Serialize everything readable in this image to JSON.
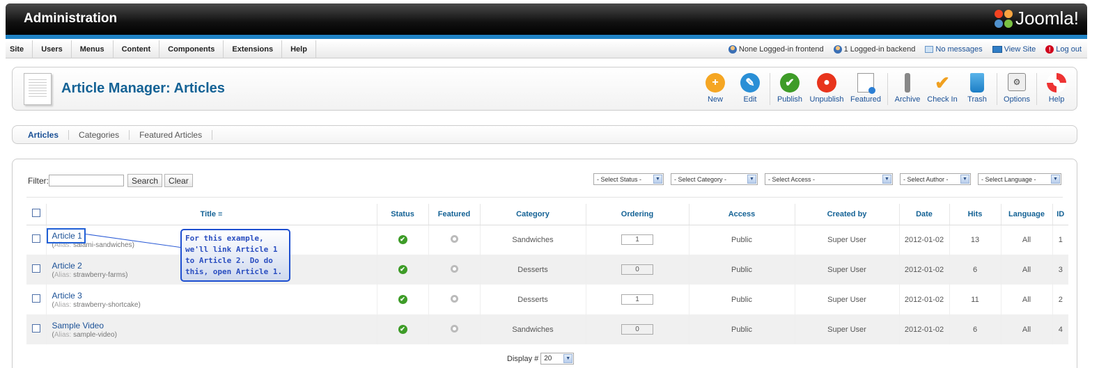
{
  "header": {
    "title": "Administration",
    "logo_text": "Joomla!"
  },
  "menu": [
    "Site",
    "Users",
    "Menus",
    "Content",
    "Components",
    "Extensions",
    "Help"
  ],
  "status": {
    "frontend": "None Logged-in frontend",
    "backend": "1 Logged-in backend",
    "messages": "No messages",
    "view_site": "View Site",
    "logout": "Log out"
  },
  "toolbar": {
    "page_title": "Article Manager: Articles",
    "buttons": {
      "new": "New",
      "edit": "Edit",
      "publish": "Publish",
      "unpublish": "Unpublish",
      "featured": "Featured",
      "archive": "Archive",
      "checkin": "Check In",
      "trash": "Trash",
      "options": "Options",
      "help": "Help"
    },
    "colors": {
      "new": "#f5a623",
      "edit": "#2a8fd6",
      "publish": "#3e9c28",
      "unpublish": "#e8341c"
    }
  },
  "subtabs": [
    "Articles",
    "Categories",
    "Featured Articles"
  ],
  "filter": {
    "label": "Filter:",
    "value": "",
    "search_label": "Search",
    "clear_label": "Clear"
  },
  "selects": {
    "status": "- Select Status -",
    "category": "- Select Category -",
    "access": "- Select Access -",
    "author": "- Select Author -",
    "language": "- Select Language -"
  },
  "table": {
    "headers": {
      "title": "Title",
      "status": "Status",
      "featured": "Featured",
      "category": "Category",
      "ordering": "Ordering",
      "access": "Access",
      "created_by": "Created by",
      "date": "Date",
      "hits": "Hits",
      "language": "Language",
      "id": "ID"
    },
    "alias_label": "Alias:",
    "rows": [
      {
        "title": "Article 1",
        "alias": "salami-sandwiches",
        "category": "Sandwiches",
        "ordering": "1",
        "access": "Public",
        "created_by": "Super User",
        "date": "2012-01-02",
        "hits": "13",
        "language": "All",
        "id": "1"
      },
      {
        "title": "Article 2",
        "alias": "strawberry-farms",
        "category": "Desserts",
        "ordering": "0",
        "access": "Public",
        "created_by": "Super User",
        "date": "2012-01-02",
        "hits": "6",
        "language": "All",
        "id": "3"
      },
      {
        "title": "Article 3",
        "alias": "strawberry-shortcake",
        "category": "Desserts",
        "ordering": "1",
        "access": "Public",
        "created_by": "Super User",
        "date": "2012-01-02",
        "hits": "11",
        "language": "All",
        "id": "2"
      },
      {
        "title": "Sample Video",
        "alias": "sample-video",
        "category": "Sandwiches",
        "ordering": "0",
        "access": "Public",
        "created_by": "Super User",
        "date": "2012-01-02",
        "hits": "6",
        "language": "All",
        "id": "4"
      }
    ]
  },
  "display": {
    "label": "Display #",
    "value": "20"
  },
  "callout": {
    "line1": "For this example,",
    "line2": "we'll link Article 1",
    "line3": "to Article 2. Do do",
    "line4": "this, open Article 1."
  }
}
